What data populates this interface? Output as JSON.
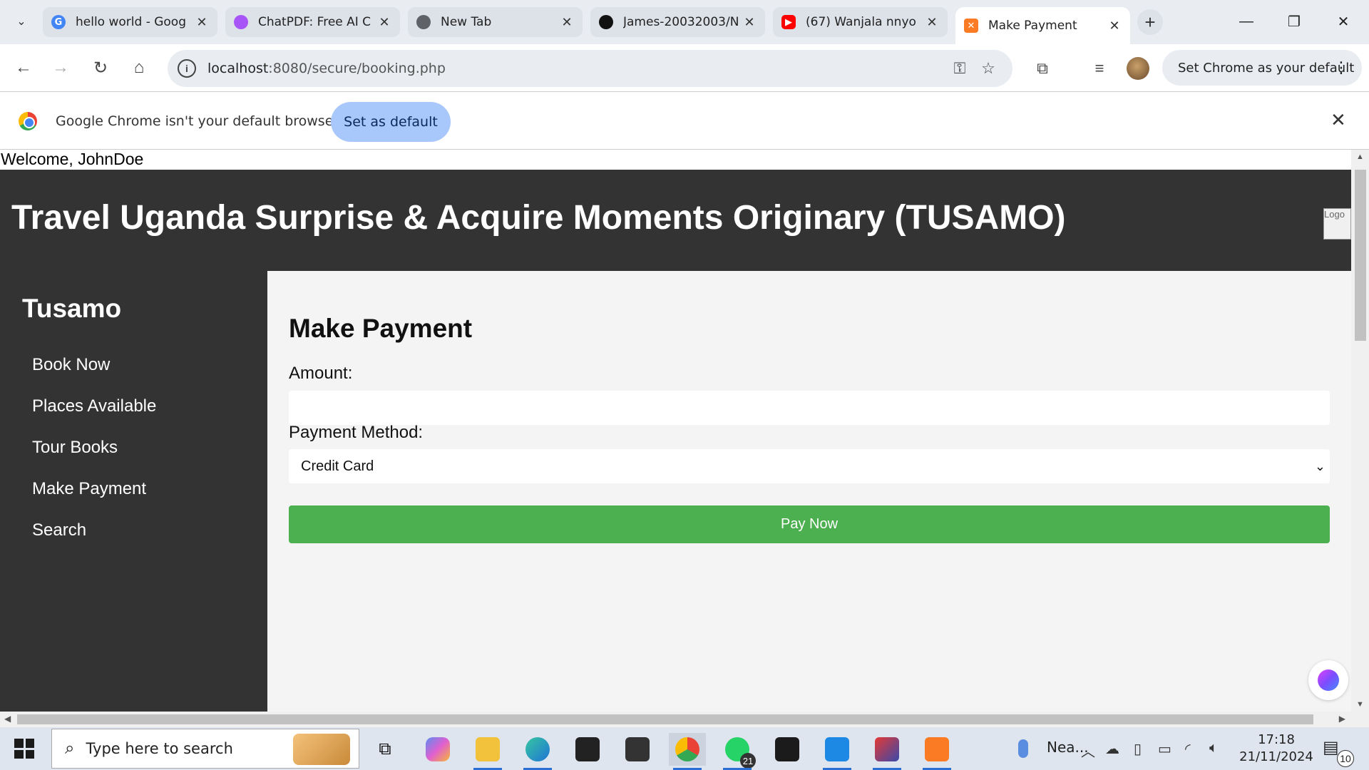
{
  "browser": {
    "tabs": [
      {
        "title": "hello world - Goog",
        "favicon": "google-icon",
        "color": "#4285f4"
      },
      {
        "title": "ChatPDF: Free AI C",
        "favicon": "chatpdf-icon",
        "color": "#a855f7"
      },
      {
        "title": "New Tab",
        "favicon": "chrome-icon",
        "color": "#5f6368"
      },
      {
        "title": "James-20032003/N",
        "favicon": "github-icon",
        "color": "#111111"
      },
      {
        "title": "(67) Wanjala nnyo",
        "favicon": "youtube-icon",
        "color": "#ff0000"
      },
      {
        "title": "Make Payment",
        "favicon": "xampp-icon",
        "color": "#fb7a24"
      }
    ],
    "url_host": "localhost",
    "url_path": ":8080/secure/booking.php",
    "set_default_label": "Set Chrome as your default",
    "infobar": {
      "message": "Google Chrome isn't your default browser",
      "button": "Set as default"
    }
  },
  "page": {
    "welcome": "Welcome, JohnDoe",
    "site_title": "Travel Uganda Surprise & Acquire Moments Originary (TUSAMO)",
    "logo_alt": "Logo",
    "sidebar": {
      "brand": "Tusamo",
      "items": [
        "Book Now",
        "Places Available",
        "Tour Books",
        "Make Payment",
        "Search"
      ]
    },
    "form": {
      "heading": "Make Payment",
      "amount_label": "Amount:",
      "amount_value": "",
      "method_label": "Payment Method:",
      "method_value": "Credit Card",
      "submit": "Pay Now"
    },
    "colors": {
      "header": "#333333",
      "button": "#4caf50",
      "content_bg": "#f4f4f4"
    }
  },
  "taskbar": {
    "search_placeholder": "Type here to search",
    "whatsapp_badge": "21",
    "weather": "Nea...",
    "time": "17:18",
    "date": "21/11/2024",
    "notifications": "10"
  }
}
